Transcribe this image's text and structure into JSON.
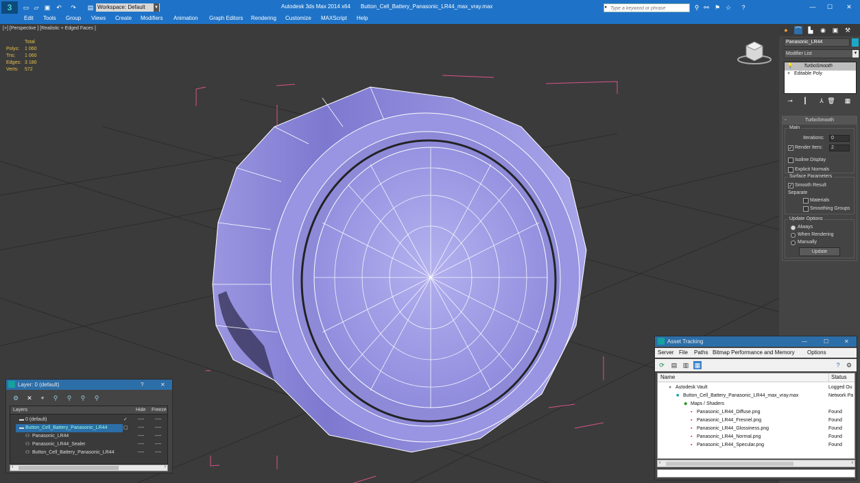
{
  "title_bar": {
    "workspace_label": "Workspace: Default",
    "app_title": "Autodesk 3ds Max  2014 x64",
    "file_name": "Button_Cell_Battery_Panasonic_LR44_max_vray.max",
    "search_placeholder": "Type a keyword or phrase"
  },
  "menu": [
    "Edit",
    "Tools",
    "Group",
    "Views",
    "Create",
    "Modifiers",
    "Animation",
    "Graph Editors",
    "Rendering",
    "Customize",
    "MAXScript",
    "Help"
  ],
  "viewport": {
    "label": "[+] [Perspective ] [Realistic + Edged Faces ]",
    "stats": {
      "header": "Total",
      "rows": [
        {
          "label": "Polys:",
          "value": "1 060"
        },
        {
          "label": "Tris:",
          "value": "1 060"
        },
        {
          "label": "Edges:",
          "value": "3 180"
        },
        {
          "label": "Verts:",
          "value": "572"
        }
      ]
    }
  },
  "command_panel": {
    "object_name": "Panasonic_LR44",
    "modifier_list_label": "Modifier List",
    "stack": [
      "TurboSmooth",
      "Editable Poly"
    ],
    "rollout_title": "TurboSmooth",
    "main_group": "Main",
    "iterations_label": "Iterations:",
    "iterations_value": "0",
    "render_iters_label": "Render Iters:",
    "render_iters_value": "2",
    "isoline_label": "Isoline Display",
    "explicit_normals_label": "Explicit Normals",
    "surface_group": "Surface Parameters",
    "smooth_result_label": "Smooth Result",
    "separate_label": "Separate",
    "materials_label": "Materials",
    "smoothing_groups_label": "Smoothing Groups",
    "update_group": "Update Options",
    "always_label": "Always",
    "when_rendering_label": "When Rendering",
    "manually_label": "Manually",
    "update_button": "Update"
  },
  "layer_panel": {
    "title": "Layer: 0 (default)",
    "help": "?",
    "columns": {
      "layers": "Layers",
      "hide": "Hide",
      "freeze": "Freeze"
    },
    "rows": [
      {
        "name": "0 (default)",
        "hide": "----",
        "freeze": "----"
      },
      {
        "name": "Button_Cell_Battery_Panasonic_LR44",
        "hide": "----",
        "freeze": "----"
      },
      {
        "name": "Panasonic_LR44",
        "hide": "----",
        "freeze": "----"
      },
      {
        "name": "Panasonic_LR44_Sealer",
        "hide": "----",
        "freeze": "----"
      },
      {
        "name": "Button_Cell_Battery_Panasonic_LR44",
        "hide": "----",
        "freeze": "----"
      }
    ]
  },
  "asset_panel": {
    "title": "Asset Tracking",
    "menu": [
      "Server",
      "File",
      "Paths",
      "Bitmap Performance and Memory",
      "Options"
    ],
    "columns": {
      "name": "Name",
      "status": "Status"
    },
    "rows": [
      {
        "name": "Autodesk Vault",
        "status": "Logged Ou",
        "indent": 1
      },
      {
        "name": "Button_Cell_Battery_Panasonic_LR44_max_vray.max",
        "status": "Network Pa",
        "indent": 2
      },
      {
        "name": "Maps / Shaders",
        "status": "",
        "indent": 3
      },
      {
        "name": "Panasonic_LR44_Diffuse.png",
        "status": "Found",
        "indent": 4
      },
      {
        "name": "Panasonic_LR44_Fresnel.png",
        "status": "Found",
        "indent": 4
      },
      {
        "name": "Panasonic_LR44_Glossiness.png",
        "status": "Found",
        "indent": 4
      },
      {
        "name": "Panasonic_LR44_Normal.png",
        "status": "Found",
        "indent": 4
      },
      {
        "name": "Panasonic_LR44_Specular.png",
        "status": "Found",
        "indent": 4
      }
    ]
  },
  "colors": {
    "title_blue": "#1e73c8",
    "model": "#8c87dc",
    "wire": "#ffffff",
    "bbox": "#d9538a"
  }
}
